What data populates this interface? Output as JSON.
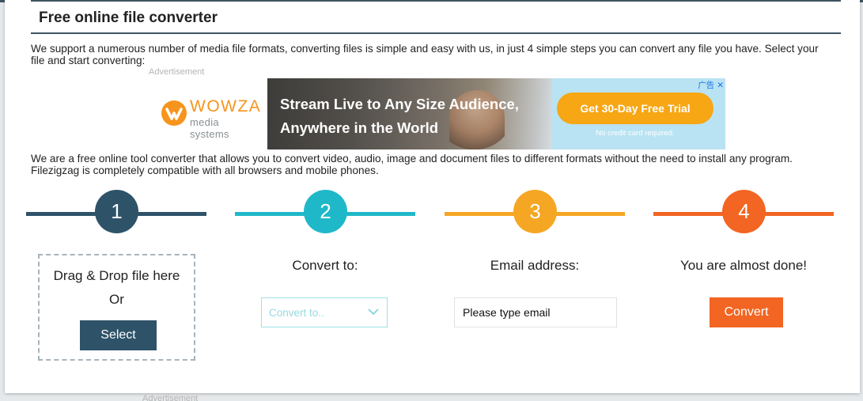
{
  "colors": {
    "header_rule": "#3d5360",
    "step1": "#2e5369",
    "step2": "#1fb8c9",
    "step3": "#f5a623",
    "step4": "#f26522",
    "convert_button": "#f26522",
    "select_button": "#2e5369"
  },
  "header": {
    "title": "Free online file converter"
  },
  "intro": "We support a numerous number of media file formats, converting files is simple and easy with us, in just 4 simple steps you can convert any file you have. Select your file and start converting:",
  "advertisement": {
    "label": "Advertisement",
    "brand_name": "WOWZA",
    "brand_sub": "media systems",
    "headline_line1": "Stream Live to Any Size Audience,",
    "headline_line2": "Anywhere in the World",
    "cta": "Get 30-Day Free Trial",
    "note": "No credit card required.",
    "corner_label": "广告",
    "corner_close": "✕"
  },
  "description": "We are a free online tool converter that allows you to convert video, audio, image and document files to different formats without the need to install any program. Filezigzag is completely compatible with all browsers and mobile phones.",
  "steps": [
    {
      "number": "1",
      "label": ""
    },
    {
      "number": "2",
      "label": "Convert to:"
    },
    {
      "number": "3",
      "label": "Email address:"
    },
    {
      "number": "4",
      "label": "You are almost done!"
    }
  ],
  "upload": {
    "line1": "Drag & Drop file here",
    "line2": "Or",
    "select_label": "Select"
  },
  "convert_to": {
    "placeholder": "Convert to..",
    "icon": "chevron-down-icon"
  },
  "email": {
    "placeholder": "Please type email",
    "value": ""
  },
  "convert_button": {
    "label": "Convert"
  },
  "footer_fragment": "Advertisement"
}
